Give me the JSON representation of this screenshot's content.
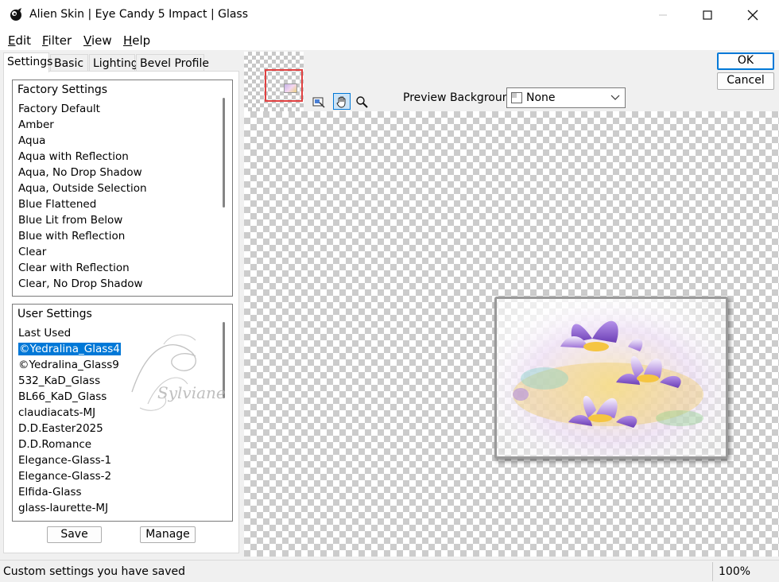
{
  "window": {
    "title": "Alien Skin | Eye Candy 5 Impact | Glass",
    "controls": [
      "minimize-icon",
      "maximize-icon",
      "close-icon"
    ]
  },
  "menu": {
    "items": [
      {
        "first": "E",
        "rest": "dit"
      },
      {
        "first": "F",
        "rest": "ilter"
      },
      {
        "first": "V",
        "rest": "iew"
      },
      {
        "first": "H",
        "rest": "elp"
      }
    ]
  },
  "tabs": [
    "Settings",
    "Basic",
    "Lighting",
    "Bevel Profile"
  ],
  "factory_settings": {
    "header": "Factory Settings",
    "items": [
      "Factory Default",
      "Amber",
      "Aqua",
      "Aqua with Reflection",
      "Aqua, No Drop Shadow",
      "Aqua, Outside Selection",
      "Blue Flattened",
      "Blue Lit from Below",
      "Blue with Reflection",
      "Clear",
      "Clear with Reflection",
      "Clear, No Drop Shadow"
    ]
  },
  "user_settings": {
    "header": "User Settings",
    "items": [
      "Last Used",
      "©Yedralina_Glass4",
      "©Yedralina_Glass9",
      "532_KaD_Glass",
      "BL66_KaD_Glass",
      "claudiacats-MJ",
      "D.D.Easter2025",
      "D.D.Romance",
      "Elegance-Glass-1",
      "Elegance-Glass-2",
      "Elfida-Glass",
      "glass-laurette-MJ"
    ],
    "selected": "©Yedralina_Glass4"
  },
  "watermark_text": "Sylviane",
  "buttons": {
    "save": "Save",
    "manage": "Manage",
    "ok": "OK",
    "cancel": "Cancel"
  },
  "preview_background": {
    "label": "Preview Background:",
    "value": "None"
  },
  "tools": [
    "navigator-icon",
    "hand-icon",
    "zoom-icon"
  ],
  "status": {
    "message": "Custom settings you have saved",
    "zoom": "100%"
  },
  "colors": {
    "selection": "#0078d7",
    "navigator_frame": "#e04040"
  }
}
